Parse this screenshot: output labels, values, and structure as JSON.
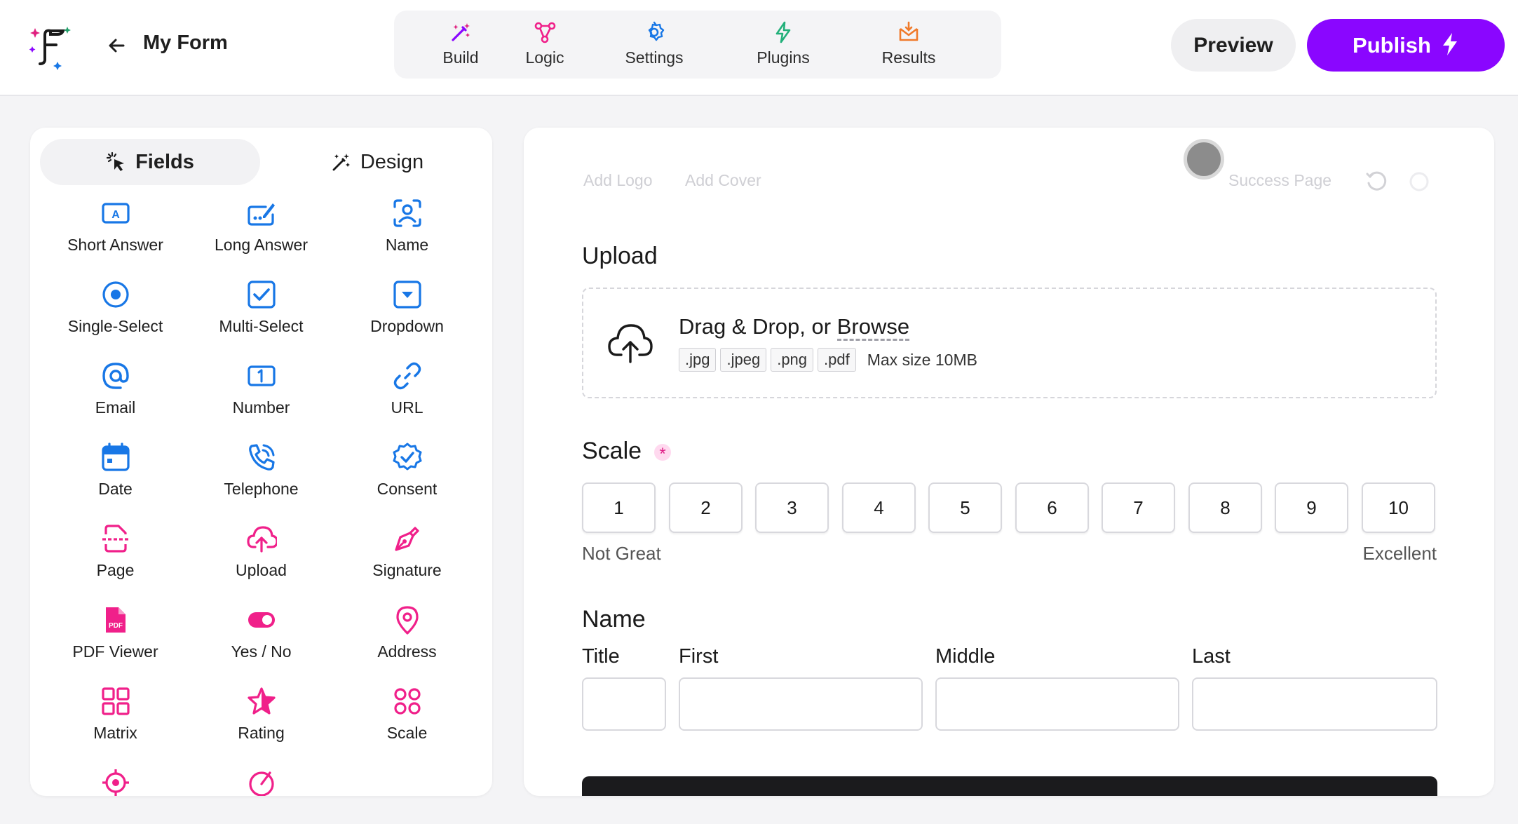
{
  "header": {
    "form_title": "My Form",
    "tabs": [
      {
        "label": "Build",
        "icon": "magic-wand-icon"
      },
      {
        "label": "Logic",
        "icon": "logic-nodes-icon"
      },
      {
        "label": "Settings",
        "icon": "gear-icon"
      },
      {
        "label": "Plugins",
        "icon": "bolt-icon"
      },
      {
        "label": "Results",
        "icon": "inbox-icon"
      }
    ],
    "preview_label": "Preview",
    "publish_label": "Publish"
  },
  "sidebar": {
    "tab_fields": "Fields",
    "tab_design": "Design",
    "fields": [
      {
        "label": "Short Answer",
        "icon": "short-answer-icon"
      },
      {
        "label": "Long Answer",
        "icon": "long-answer-icon"
      },
      {
        "label": "Name",
        "icon": "name-icon"
      },
      {
        "label": "Single-Select",
        "icon": "radio-icon"
      },
      {
        "label": "Multi-Select",
        "icon": "checkbox-icon"
      },
      {
        "label": "Dropdown",
        "icon": "dropdown-icon"
      },
      {
        "label": "Email",
        "icon": "at-icon"
      },
      {
        "label": "Number",
        "icon": "number-icon"
      },
      {
        "label": "URL",
        "icon": "link-icon"
      },
      {
        "label": "Date",
        "icon": "calendar-icon"
      },
      {
        "label": "Telephone",
        "icon": "phone-icon"
      },
      {
        "label": "Consent",
        "icon": "badge-check-icon"
      },
      {
        "label": "Page",
        "icon": "page-icon"
      },
      {
        "label": "Upload",
        "icon": "cloud-upload-icon"
      },
      {
        "label": "Signature",
        "icon": "pen-icon"
      },
      {
        "label": "PDF Viewer",
        "icon": "pdf-icon"
      },
      {
        "label": "Yes / No",
        "icon": "toggle-icon"
      },
      {
        "label": "Address",
        "icon": "map-pin-icon"
      },
      {
        "label": "Matrix",
        "icon": "grid-icon"
      },
      {
        "label": "Rating",
        "icon": "star-icon"
      },
      {
        "label": "Scale",
        "icon": "dots-grid-icon"
      }
    ],
    "colors": {
      "blue": "#1877e6",
      "pink": "#f0208a"
    }
  },
  "canvas": {
    "add_logo": "Add Logo",
    "add_cover": "Add Cover",
    "success_page": "Success Page",
    "upload": {
      "label": "Upload",
      "drag_text": "Drag & Drop, or ",
      "browse_text": "Browse",
      "extensions": [
        ".jpg",
        ".jpeg",
        ".png",
        ".pdf"
      ],
      "max_size": "Max size 10MB"
    },
    "scale": {
      "label": "Scale",
      "required_mark": "*",
      "options": [
        "1",
        "2",
        "3",
        "4",
        "5",
        "6",
        "7",
        "8",
        "9",
        "10"
      ],
      "low_label": "Not Great",
      "high_label": "Excellent"
    },
    "name": {
      "label": "Name",
      "title_label": "Title",
      "first_label": "First",
      "middle_label": "Middle",
      "last_label": "Last"
    }
  }
}
